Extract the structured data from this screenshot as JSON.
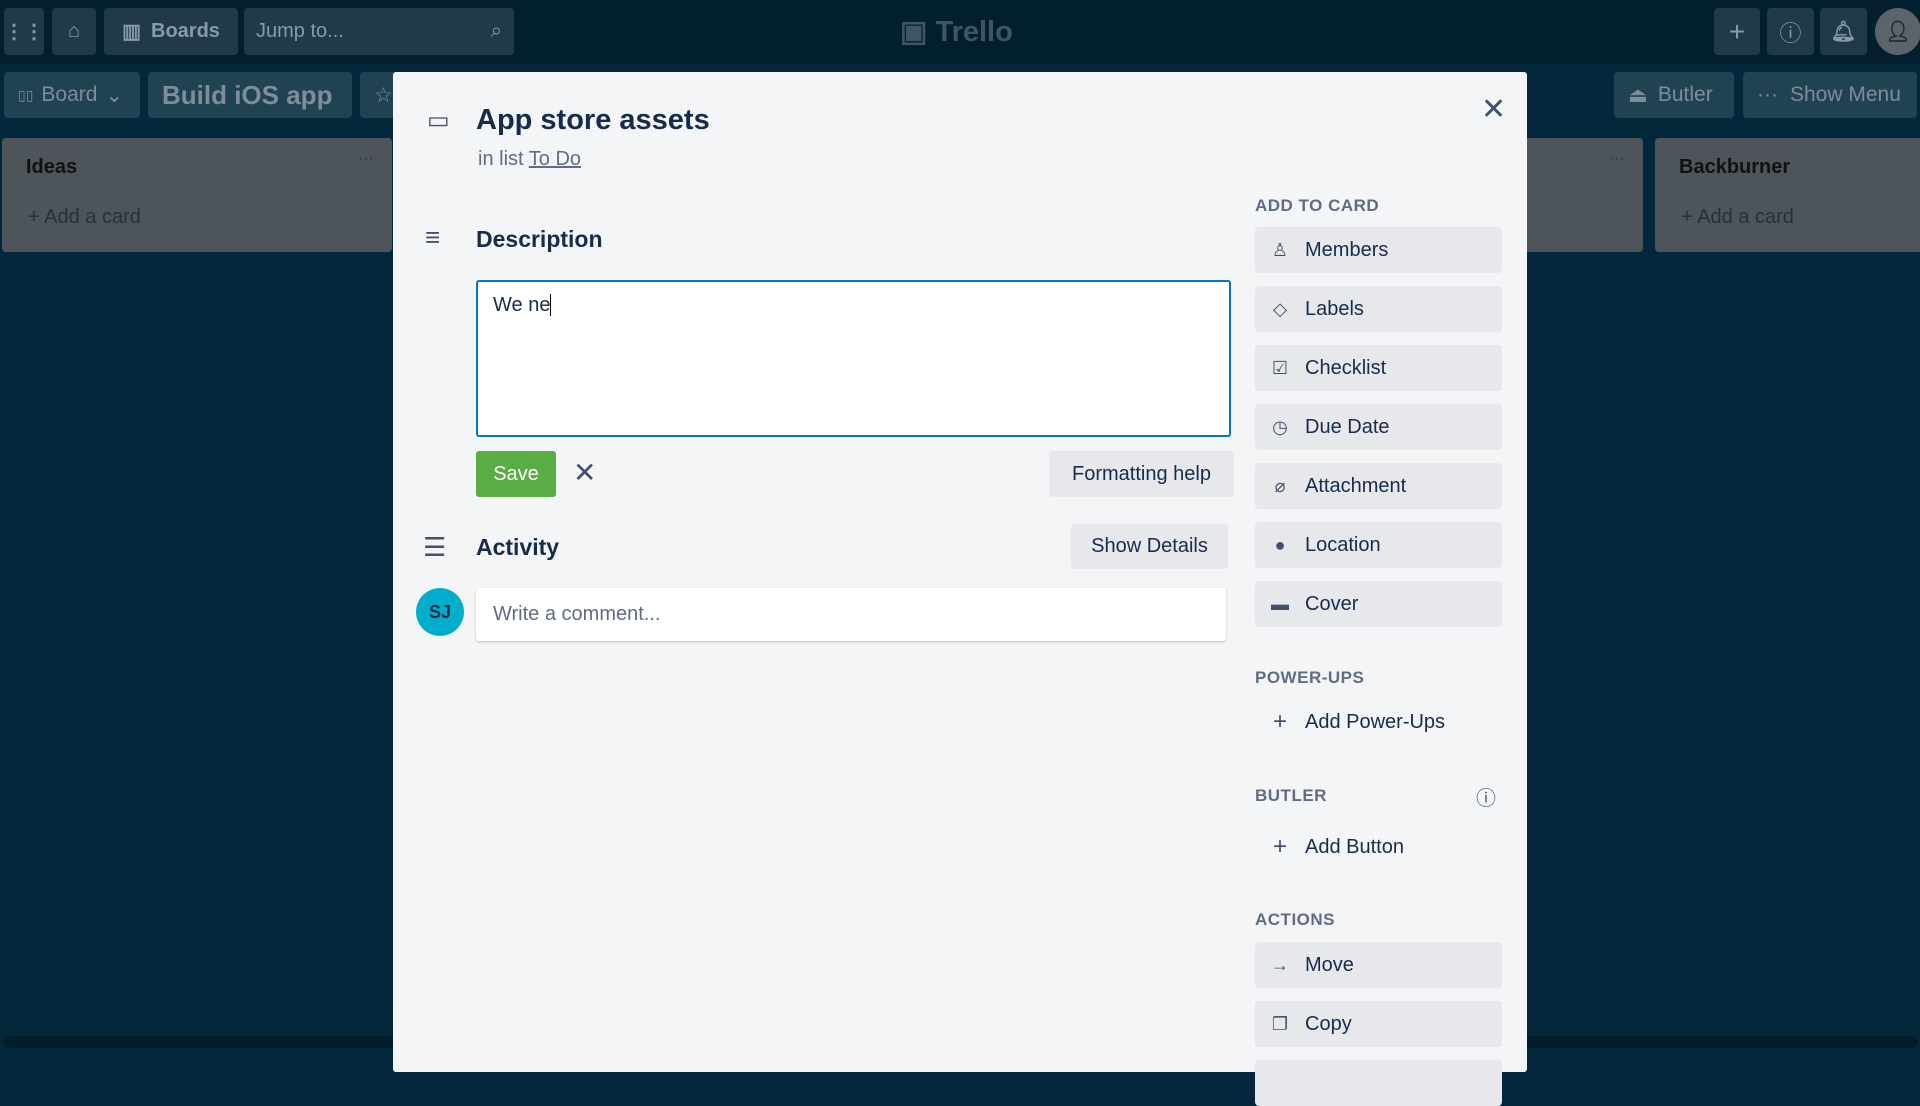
{
  "header": {
    "boards_label": "Boards",
    "search_placeholder": "Jump to...",
    "logo": "Trello"
  },
  "board_bar": {
    "view_label": "Board",
    "board_name": "Build iOS app",
    "butler_label": "Butler",
    "menu_label": "Show Menu"
  },
  "lists": [
    {
      "title": "Ideas",
      "add_label": "Add a card"
    },
    {
      "title": "Backburner",
      "add_label": "Add a card"
    }
  ],
  "card": {
    "title": "App store assets",
    "in_list_prefix": "in list",
    "list_name": "To Do",
    "description": {
      "heading": "Description",
      "value": "We ne",
      "save_label": "Save",
      "formatting_help": "Formatting help"
    },
    "activity": {
      "heading": "Activity",
      "show_details": "Show Details",
      "avatar_initials": "SJ",
      "comment_placeholder": "Write a comment..."
    }
  },
  "sidebar": {
    "add_to_card": {
      "heading": "ADD TO CARD",
      "items": [
        {
          "label": "Members",
          "icon": "person-icon"
        },
        {
          "label": "Labels",
          "icon": "tag-icon"
        },
        {
          "label": "Checklist",
          "icon": "checkbox-icon"
        },
        {
          "label": "Due Date",
          "icon": "clock-icon"
        },
        {
          "label": "Attachment",
          "icon": "paperclip-icon"
        },
        {
          "label": "Location",
          "icon": "pin-icon"
        },
        {
          "label": "Cover",
          "icon": "cover-icon"
        }
      ]
    },
    "power_ups": {
      "heading": "POWER-UPS",
      "add_label": "Add Power-Ups"
    },
    "butler": {
      "heading": "BUTLER",
      "add_label": "Add Button"
    },
    "actions": {
      "heading": "ACTIONS",
      "items": [
        {
          "label": "Move",
          "icon": "arrow-right-icon"
        },
        {
          "label": "Copy",
          "icon": "copy-icon"
        }
      ]
    }
  },
  "colors": {
    "accent": "#0079bf",
    "save": "#5aac44",
    "avatar": "#00aecc"
  }
}
